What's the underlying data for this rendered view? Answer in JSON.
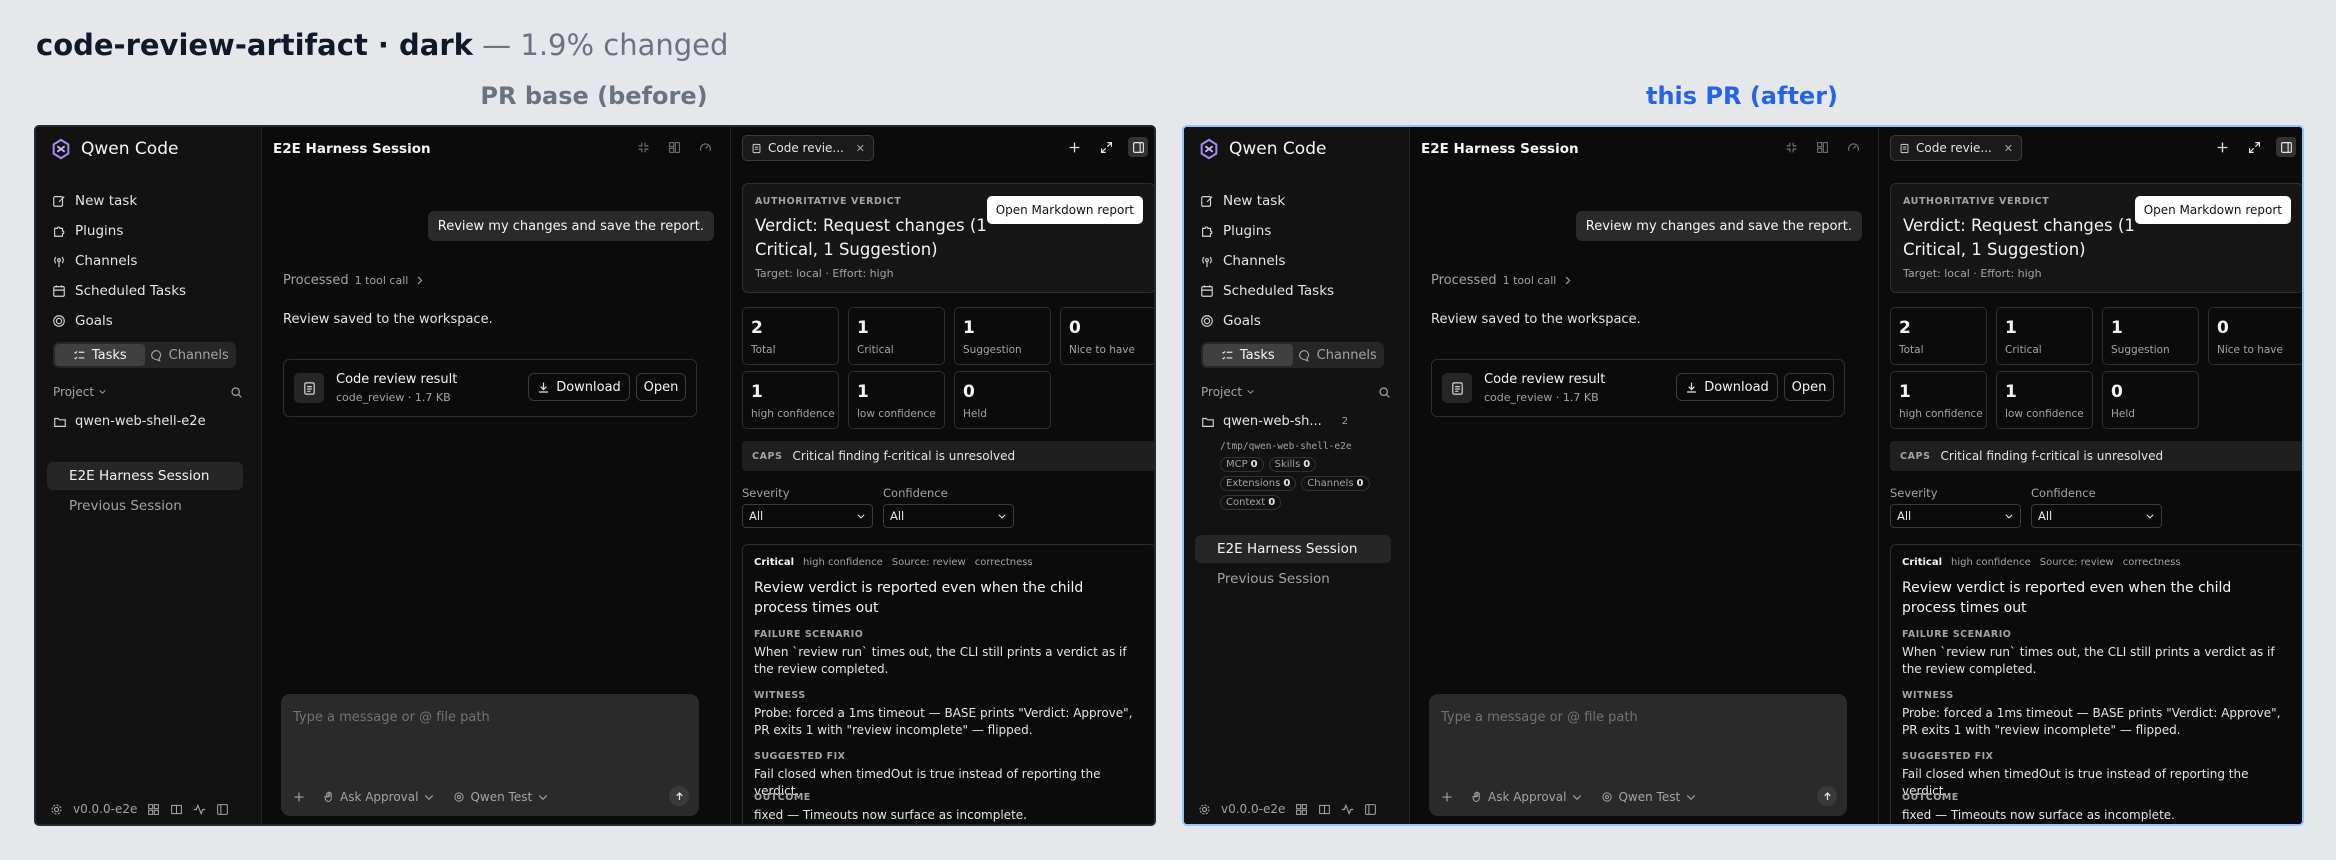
{
  "header": {
    "title_main": "code-review-artifact · dark",
    "title_sub": " — 1.9% changed",
    "label_before": "PR base (before)",
    "label_after": "this PR (after)"
  },
  "colors": {
    "after_accent": "#2563eb",
    "panel_bg": "#0b0b0b",
    "sidebar_bg": "#121212"
  },
  "app": {
    "brand": "Qwen Code",
    "nav": [
      {
        "label": "New task",
        "icon": "edit-icon"
      },
      {
        "label": "Plugins",
        "icon": "puzzle-icon"
      },
      {
        "label": "Channels",
        "icon": "broadcast-icon"
      },
      {
        "label": "Scheduled Tasks",
        "icon": "calendar-icon"
      },
      {
        "label": "Goals",
        "icon": "target-icon"
      }
    ],
    "seg_tasks": "Tasks",
    "seg_channels": "Channels",
    "project_label": "Project",
    "folder_before": "qwen-web-shell-e2e",
    "folder_after": "qwen-web-sh...",
    "folder_count": "2",
    "folder_path": "/tmp/qwen-web-shell-e2e",
    "badges": [
      {
        "label": "MCP",
        "value": "0"
      },
      {
        "label": "Skills",
        "value": "0"
      },
      {
        "label": "Extensions",
        "value": "0"
      },
      {
        "label": "Channels",
        "value": "0"
      },
      {
        "label": "Context",
        "value": "0"
      }
    ],
    "sessions": [
      "E2E Harness Session",
      "Previous Session"
    ],
    "version": "v0.0.0-e2e"
  },
  "chat": {
    "title": "E2E Harness Session",
    "user_message": "Review my changes and save the report.",
    "processed": "Processed",
    "tool_calls": "1 tool call",
    "assistant_message": "Review saved to the workspace.",
    "result_title": "Code review result",
    "result_meta": "code_review · 1.7 KB",
    "download": "Download",
    "open": "Open",
    "composer_placeholder": "Type a message or @ file path",
    "approval": "Ask Approval",
    "model": "Qwen Test"
  },
  "review": {
    "tab_label": "Code revie...",
    "verdict_label": "AUTHORITATIVE VERDICT",
    "verdict": "Verdict: Request changes (1 Critical, 1 Suggestion)",
    "verdict_meta": "Target: local · Effort: high",
    "md_button": "Open Markdown report",
    "stats": [
      {
        "n": "2",
        "l": "Total"
      },
      {
        "n": "1",
        "l": "Critical"
      },
      {
        "n": "1",
        "l": "Suggestion"
      },
      {
        "n": "0",
        "l": "Nice to have"
      },
      {
        "n": "1",
        "l": "high confidence"
      },
      {
        "n": "1",
        "l": "low confidence"
      },
      {
        "n": "0",
        "l": "Held"
      }
    ],
    "caps_tag": "CAPS",
    "caps_text": "Critical finding f-critical is unresolved",
    "severity_label": "Severity",
    "confidence_label": "Confidence",
    "all": "All",
    "finding": {
      "severity": "Critical",
      "confidence": "high confidence",
      "source": "Source: review",
      "category": "correctness",
      "title": "Review verdict is reported even when the child process times out",
      "h_failure": "FAILURE SCENARIO",
      "failure": "When `review run` times out, the CLI still prints a verdict as if the review completed.",
      "h_witness": "WITNESS",
      "witness": "Probe: forced a 1ms timeout — BASE prints \"Verdict: Approve\", PR exits 1 with \"review incomplete\" — flipped.",
      "h_fix": "SUGGESTED FIX",
      "fix": "Fail closed when timedOut is true instead of reporting the verdict.",
      "h_outcome": "OUTCOME",
      "outcome": "fixed — Timeouts now surface as incomplete."
    }
  }
}
